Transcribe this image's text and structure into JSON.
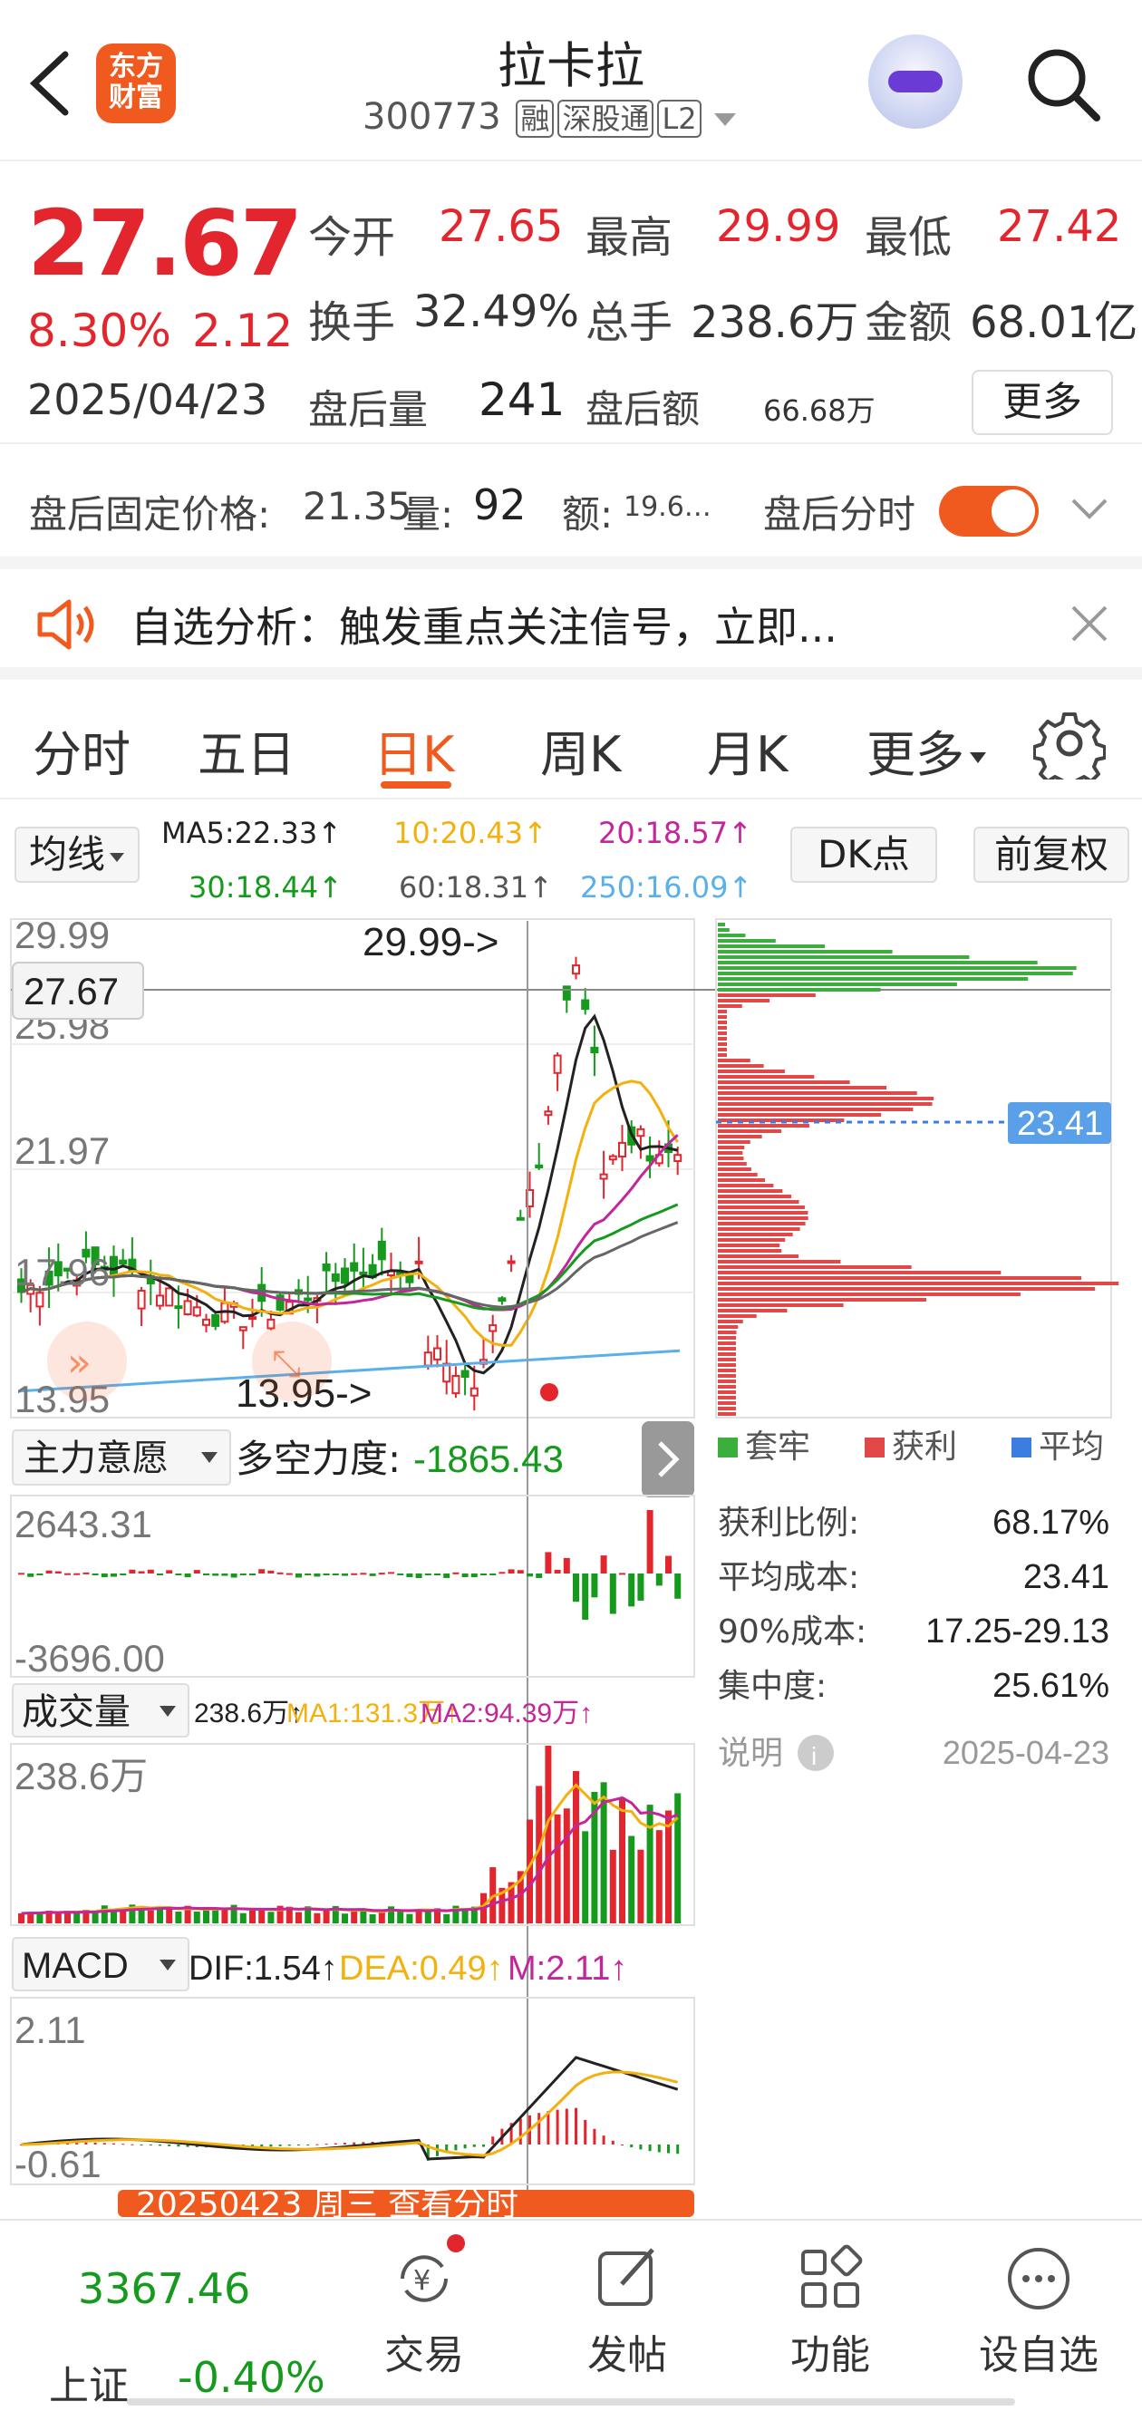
{
  "header": {
    "logo_text_1": "东方",
    "logo_text_2": "财富",
    "stock_name": "拉卡拉",
    "code": "300773",
    "tags": [
      "融",
      "深股通",
      "L2"
    ]
  },
  "quote": {
    "price": "27.67",
    "change_pct": "8.30%",
    "change_amt": "2.12",
    "date": "2025/04/23",
    "open_label": "今开",
    "open": "27.65",
    "high_label": "最高",
    "high": "29.99",
    "low_label": "最低",
    "low": "27.42",
    "turnover_label": "换手",
    "turnover": "32.49%",
    "volume_label": "总手",
    "volume": "238.6万",
    "amount_label": "金额",
    "amount": "68.01亿",
    "after_vol_label": "盘后量",
    "after_vol": "241",
    "after_amt_label": "盘后额",
    "after_amt": "66.68万",
    "more_label": "更多",
    "fixed_price_label": "盘后固定价格:",
    "fixed_price": "21.35",
    "fixed_vol_label": "量:",
    "fixed_vol": "92",
    "fixed_amt_label": "额:",
    "fixed_amt": "19.6…",
    "after_time_label": "盘后分时",
    "after_time_on": true
  },
  "notice": {
    "text": "自选分析：触发重点关注信号，立即..."
  },
  "tabs": [
    "分时",
    "五日",
    "日K",
    "周K",
    "月K",
    "更多"
  ],
  "active_tab": "日K",
  "ma_row": {
    "ma_button": "均线",
    "ma5": "MA5:22.33↑",
    "ma10": "10:20.43↑",
    "ma20": "20:18.57↑",
    "ma30": "30:18.44↑",
    "ma60": "60:18.31↑",
    "ma250": "250:16.09↑",
    "dk_button": "DK点",
    "fq_button": "前复权",
    "colors": {
      "ma5": "#222222",
      "ma10": "#f2b10f",
      "ma20": "#c2269a",
      "ma30": "#159a1d",
      "ma60": "#666666",
      "ma250": "#5ab0ea"
    }
  },
  "kline": {
    "y_ticks": [
      "29.99",
      "25.98",
      "21.97",
      "17.96",
      "13.95"
    ],
    "cursor_price": "27.67",
    "max_label": "29.99->",
    "min_label": "13.95->"
  },
  "chip": {
    "avg_cost_tag": "23.41",
    "legend": [
      "套牢",
      "获利",
      "平均"
    ],
    "legend_colors": [
      "#3cae3c",
      "#e24848",
      "#3b7de0"
    ],
    "stats": [
      {
        "label": "获利比例:",
        "value": "68.17%"
      },
      {
        "label": "平均成本:",
        "value": "23.41"
      },
      {
        "label": "90%成本:",
        "value": "17.25-29.13"
      },
      {
        "label": "集中度:",
        "value": "25.61%"
      }
    ],
    "note_label": "说明",
    "note_date": "2025-04-23"
  },
  "zhuli": {
    "button": "主力意愿",
    "label": "多空力度:",
    "value": "-1865.43",
    "max": "2643.31",
    "min": "-3696.00"
  },
  "vol": {
    "button": "成交量",
    "v": "238.6万↑",
    "ma1": "MA1:131.3万↑",
    "ma2": "MA2:94.39万↑",
    "max": "238.6万"
  },
  "macd": {
    "button": "MACD",
    "dif": "DIF:1.54↑",
    "dea": "DEA:0.49↑",
    "m": "M:2.11↑",
    "max": "2.11",
    "min": "-0.61"
  },
  "banner": {
    "text": "20250423 周三 查看分时"
  },
  "bottom": {
    "index_value": "3367.46",
    "index_name": "上证",
    "index_change": "-0.40%",
    "items": [
      "交易",
      "发帖",
      "功能",
      "设自选"
    ]
  }
}
